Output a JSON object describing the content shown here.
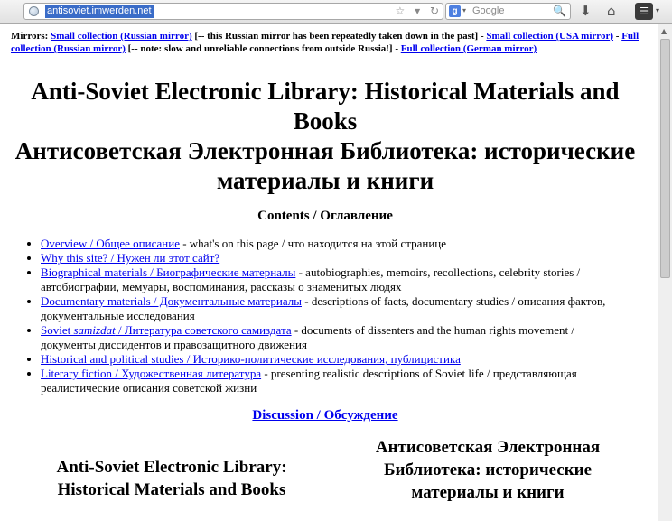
{
  "browser": {
    "url": "antisoviet.imwerden.net",
    "search_placeholder": "Google",
    "search_engine_letter": "g",
    "icons": {
      "globe": "globe-icon",
      "star": "☆",
      "dropdown": "▾",
      "reload": "↻",
      "search": "🔍",
      "download": "⬇",
      "home": "⌂",
      "menu": "☰"
    }
  },
  "mirrors": {
    "prefix": "Mirrors:",
    "link1": "Small collection (Russian mirror)",
    "note1": "[-- this Russian mirror has been repeatedly taken down in the past] -",
    "link2": "Small collection (USA mirror)",
    "sep2": "-",
    "link3": "Full collection (Russian mirror)",
    "note3": "[-- note: slow and unreliable connections from outside Russia!] -",
    "link4": "Full collection (German mirror)"
  },
  "title": {
    "en_line1": "Anti-Soviet Electronic Library: Historical Materials and",
    "en_line2": "Books",
    "ru_line1": "Антисоветская Электронная Библиотека: исторические",
    "ru_line2": "материалы и книги"
  },
  "contents_heading": "Contents / Оглавление",
  "toc": [
    {
      "link": "Overview / Общее описание",
      "desc": " - what's on this page / что находится на этой странице"
    },
    {
      "link": "Why this site? / Нужен ли этот сайт?",
      "desc": ""
    },
    {
      "link": "Biographical materials / Биографические матерналы",
      "desc": " - autobiographies, memoirs, recollections, celebrity stories / автобиографии, мемуары, воспоминания, рассказы о знаменитых людях"
    },
    {
      "link": "Documentary materials / Документальные материалы",
      "desc": " - descriptions of facts, documentary studies / описания фактов, документальные исследования"
    },
    {
      "link_pre": "Soviet ",
      "link_italic": "samizdat",
      "link_post": " / Литература советского самиздата",
      "desc": " - documents of dissenters and the human rights movement / документы диссидентов и правозащитного движения"
    },
    {
      "link": "Historical and political studies / Историко-политические исследования, публицистика",
      "desc": ""
    },
    {
      "link": "Literary fiction / Художественная литература",
      "desc": " - presenting realistic descriptions of Soviet life / представляющая реалистические описания советской жизни"
    }
  ],
  "discussion": "Discussion / Обсуждение",
  "bottom": {
    "left_line1": "Anti-Soviet Electronic Library:",
    "left_line2": "Historical Materials and Books",
    "right_line1": "Антисоветская Электронная",
    "right_line2": "Библиотека: исторические",
    "right_line3": "материалы и книги"
  }
}
